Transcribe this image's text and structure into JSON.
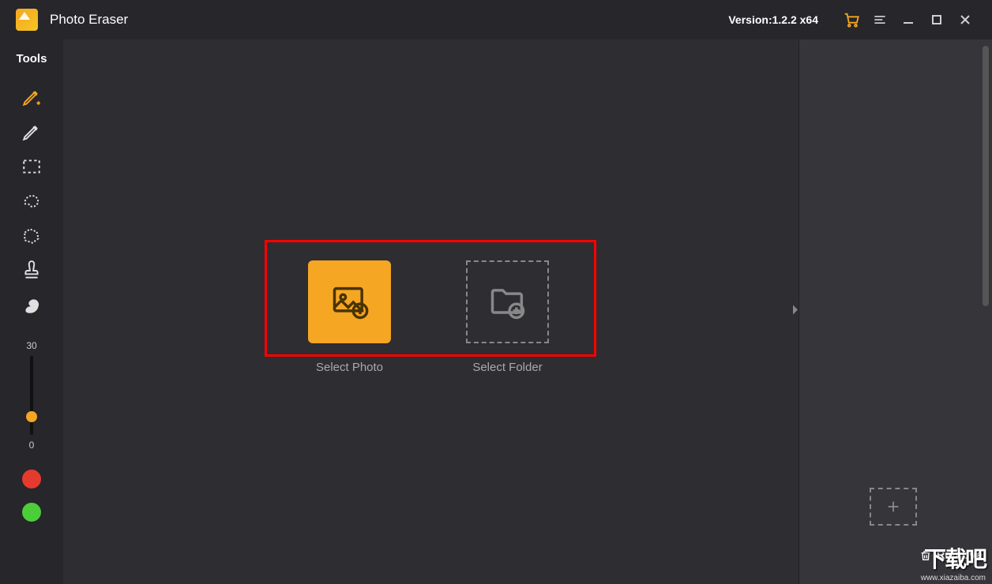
{
  "app": {
    "title": "Photo Eraser",
    "version": "Version:1.2.2 x64"
  },
  "sidebar": {
    "title": "Tools",
    "slider_max": "30",
    "slider_min": "0"
  },
  "canvas": {
    "select_photo": "Select Photo",
    "select_folder": "Select Folder"
  },
  "right": {
    "remove": "Remove"
  },
  "watermark": {
    "big": "下载吧",
    "small": "www.xiazaiba.com"
  }
}
